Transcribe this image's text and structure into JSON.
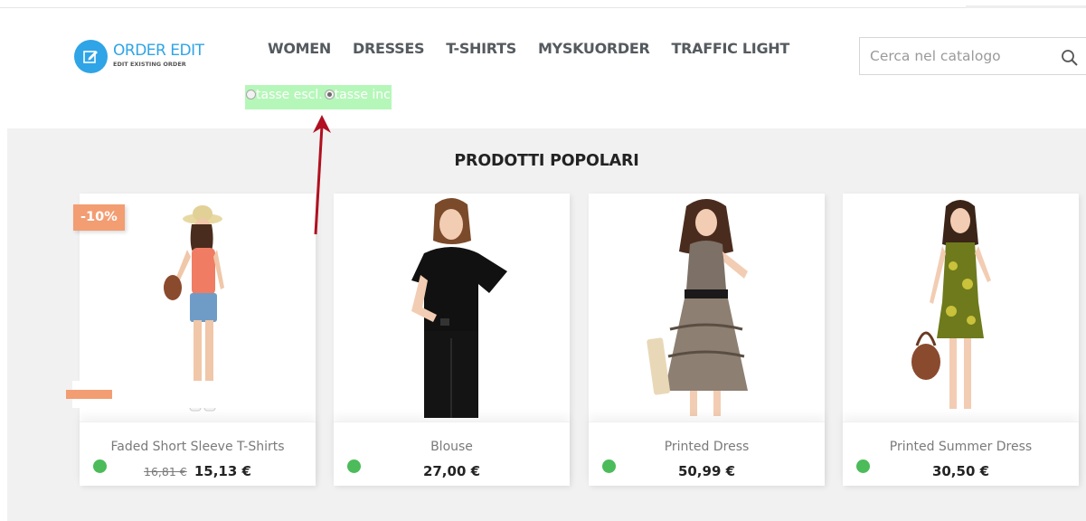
{
  "logo": {
    "title": "ORDER EDIT",
    "subtitle": "EDIT EXISTING ORDER"
  },
  "nav": {
    "items": [
      {
        "label": "WOMEN"
      },
      {
        "label": "DRESSES"
      },
      {
        "label": "T-SHIRTS"
      },
      {
        "label": "MYSKUORDER"
      },
      {
        "label": "TRAFFIC LIGHT"
      }
    ]
  },
  "search": {
    "placeholder": "Cerca nel catalogo",
    "value": ""
  },
  "tax_toggle": {
    "option_excl": "tasse escl.",
    "option_incl": "tasse incl.",
    "selected": "incl"
  },
  "section": {
    "title": "PRODOTTI POPOLARI"
  },
  "products": [
    {
      "name": "Faded Short Sleeve T-Shirts",
      "old_price": "16,81 €",
      "price": "15,13 €",
      "discount": "-10%",
      "stock_color": "#4cbb5a"
    },
    {
      "name": "Blouse",
      "old_price": "",
      "price": "27,00 €",
      "discount": "",
      "stock_color": "#4cbb5a"
    },
    {
      "name": "Printed Dress",
      "old_price": "",
      "price": "50,99 €",
      "discount": "",
      "stock_color": "#4cbb5a"
    },
    {
      "name": "Printed Summer Dress",
      "old_price": "",
      "price": "30,50 €",
      "discount": "",
      "stock_color": "#4cbb5a"
    }
  ],
  "colors": {
    "brand": "#2fa4e7",
    "discount": "#f39d72",
    "stock": "#4cbb5a",
    "tax_toggle_bg": "#b5f7b9",
    "annotation_arrow": "#b01020"
  }
}
